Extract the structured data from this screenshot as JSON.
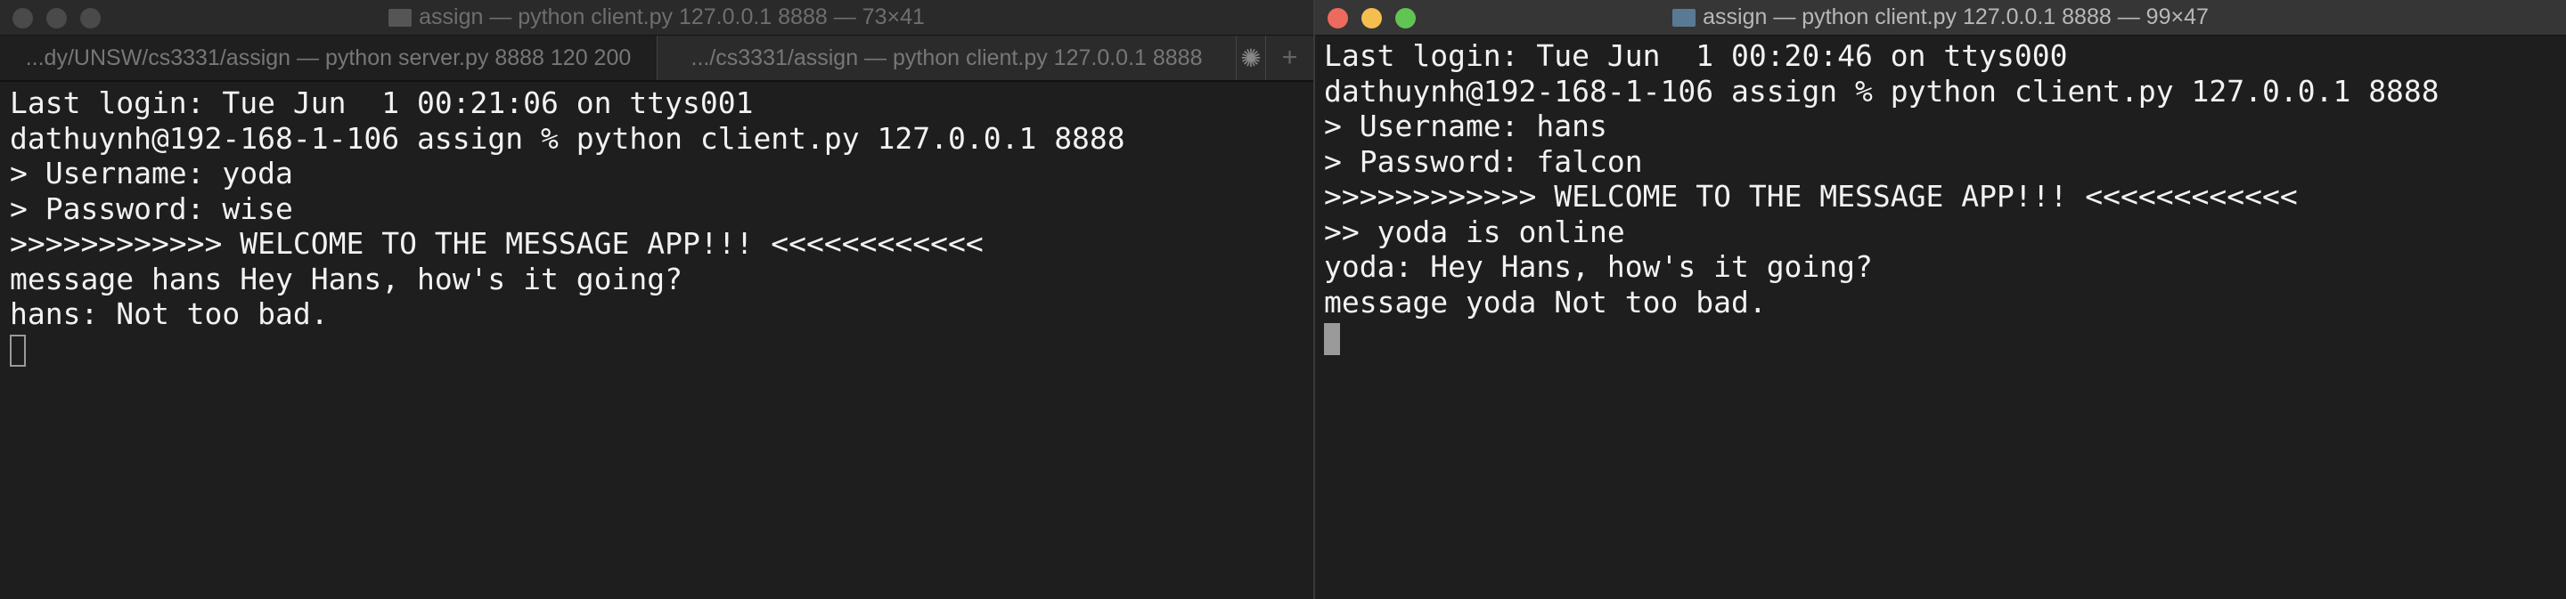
{
  "left_window": {
    "title": "assign — python client.py 127.0.0.1 8888 — 73×41",
    "active": false,
    "tabs": [
      {
        "label": "...dy/UNSW/cs3331/assign — python server.py 8888 120 200"
      },
      {
        "label": ".../cs3331/assign — python client.py 127.0.0.1 8888"
      }
    ],
    "lines": [
      "Last login: Tue Jun  1 00:21:06 on ttys001",
      "dathuynh@192-168-1-106 assign % python client.py 127.0.0.1 8888",
      "> Username: yoda",
      "> Password: wise",
      ">>>>>>>>>>>> WELCOME TO THE MESSAGE APP!!! <<<<<<<<<<<<",
      "message hans Hey Hans, how's it going?",
      "hans: Not too bad."
    ]
  },
  "right_window": {
    "title": "assign — python client.py 127.0.0.1 8888 — 99×47",
    "active": true,
    "lines": [
      "Last login: Tue Jun  1 00:20:46 on ttys000",
      "dathuynh@192-168-1-106 assign % python client.py 127.0.0.1 8888",
      "> Username: hans",
      "> Password: falcon",
      ">>>>>>>>>>>> WELCOME TO THE MESSAGE APP!!! <<<<<<<<<<<<",
      ">> yoda is online",
      "yoda: Hey Hans, how's it going?",
      "message yoda Not too bad."
    ]
  },
  "colors": {
    "close": "#ed6a5e",
    "minimize": "#f5bf4f",
    "zoom": "#61c554",
    "inactive_light": "#4a4a4a",
    "background": "#1e1e1e",
    "text": "#f2f2f2"
  }
}
